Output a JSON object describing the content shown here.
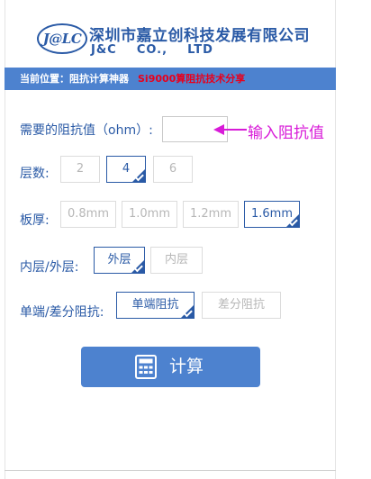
{
  "header": {
    "logo_text": "J@LC",
    "company_cn": "深圳市嘉立创科技发展有限公司",
    "company_en": "J&C    CO.,    LTD"
  },
  "breadcrumb": {
    "label": "当前位置：",
    "link": "阻抗计算神器",
    "current": "Si9000算阻抗技术分享"
  },
  "form": {
    "impedance": {
      "label": "需要的阻抗值（ohm）:",
      "value": "",
      "hint": "输入阻抗值"
    },
    "layers": {
      "label": "层数:",
      "options": [
        "2",
        "4",
        "6"
      ],
      "selected": "4"
    },
    "thickness": {
      "label": "板厚:",
      "options": [
        "0.8mm",
        "1.0mm",
        "1.2mm",
        "1.6mm"
      ],
      "selected": "1.6mm"
    },
    "layer_pos": {
      "label": "内层/外层:",
      "options": [
        "外层",
        "内层"
      ],
      "selected": "外层"
    },
    "impedance_type": {
      "label": "单端/差分阻抗:",
      "options": [
        "单端阻抗",
        "差分阻抗"
      ],
      "selected": "单端阻抗"
    }
  },
  "calc_button": {
    "label": "计算",
    "icon": "calculator-icon"
  },
  "colors": {
    "brand": "#2a5aa6",
    "bar": "#4d82cf",
    "hint": "#d81bd8",
    "alert": "#e8001c"
  }
}
